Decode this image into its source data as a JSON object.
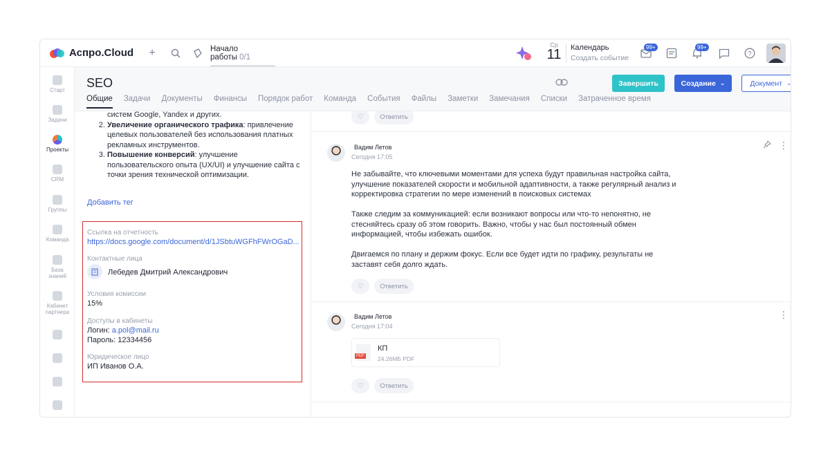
{
  "app": {
    "name": "Аспро.Cloud",
    "colors": {
      "accent": "#3a66d9",
      "finish": "#2ec3c8",
      "highlight_border": "#d42a2a"
    }
  },
  "topbar": {
    "start_work_label": "Начало работы",
    "start_work_count": "0/1",
    "calendar_weekday": "Ср",
    "calendar_day": "11",
    "calendar_title": "Календарь",
    "calendar_subtitle": "Создать событие",
    "mail_badge": "99+",
    "notif_badge": "99+"
  },
  "sidebar": {
    "items": [
      {
        "label": "Старт"
      },
      {
        "label": "Задачи"
      },
      {
        "label": "Проекты"
      },
      {
        "label": "CRM"
      },
      {
        "label": "Группы"
      },
      {
        "label": "Команда"
      },
      {
        "label": "База знаний"
      },
      {
        "label": "Кабинет партнера"
      }
    ]
  },
  "project": {
    "title": "SEO",
    "tabs": [
      "Общие",
      "Задачи",
      "Документы",
      "Финансы",
      "Порядок работ",
      "Команда",
      "События",
      "Файлы",
      "Заметки",
      "Замечания",
      "Списки",
      "Затраченное время"
    ],
    "finish_label": "Завершить",
    "create_label": "Создание",
    "document_label": "Документ"
  },
  "left": {
    "goals_pre": "систем Google, Yandex и других.",
    "goal2_bold": "Увеличение органического трафика",
    "goal2_rest": ": привлечение целевых пользователей без использования платных рекламных инструментов.",
    "goal3_bold": "Повышение конверсий",
    "goal3_rest": ": улучшение пользовательского опыта (UX/UI) и улучшение сайта с точки зрения технической оптимизации.",
    "add_tag": "Добавить тег",
    "fields": {
      "report_label": "Ссылка на отчетность",
      "report_value": "https://docs.google.com/document/d/1JSbtuWGFhFWrOGaD...",
      "contacts_label": "Контактные лица",
      "contacts_value": "Лебедев Дмитрий Александрович",
      "commission_label": "Условия комиссии",
      "commission_value": "15%",
      "access_label": "Доступы в кабинеты",
      "login_prefix": "Логин: ",
      "login_value": "a.pol@mail.ru",
      "password_line": "Пароль: 12334456",
      "legal_label": "Юридическое лицо",
      "legal_value": "ИП Иванов О.А."
    }
  },
  "feed": {
    "reply_label": "Ответить",
    "comments": [
      {
        "author": "Вадим Летов",
        "time": "Сегодня 17:05",
        "p1": "Не забывайте, что ключевыми моментами для успеха будут правильная настройка сайта, улучшение показателей скорости и мобильной адаптивности, а также регулярный анализ и корректировка стратегии по мере изменений в поисковых системах",
        "p2": "Также следим за коммуникацией: если возникают вопросы или что-то непонятно, не стесняйтесь сразу об этом говорить. Важно, чтобы у нас был постоянный обмен информацией, чтобы избежать ошибок.",
        "p3": "Двигаемся по плану и держим фокус. Если все будет идти по графику, результаты не заставят себя долго ждать."
      },
      {
        "author": "Вадим Летов",
        "time": "Сегодня 17:04",
        "file_name": "КП",
        "file_meta": "24.26МБ PDF",
        "file_type": "PDF"
      }
    ]
  }
}
